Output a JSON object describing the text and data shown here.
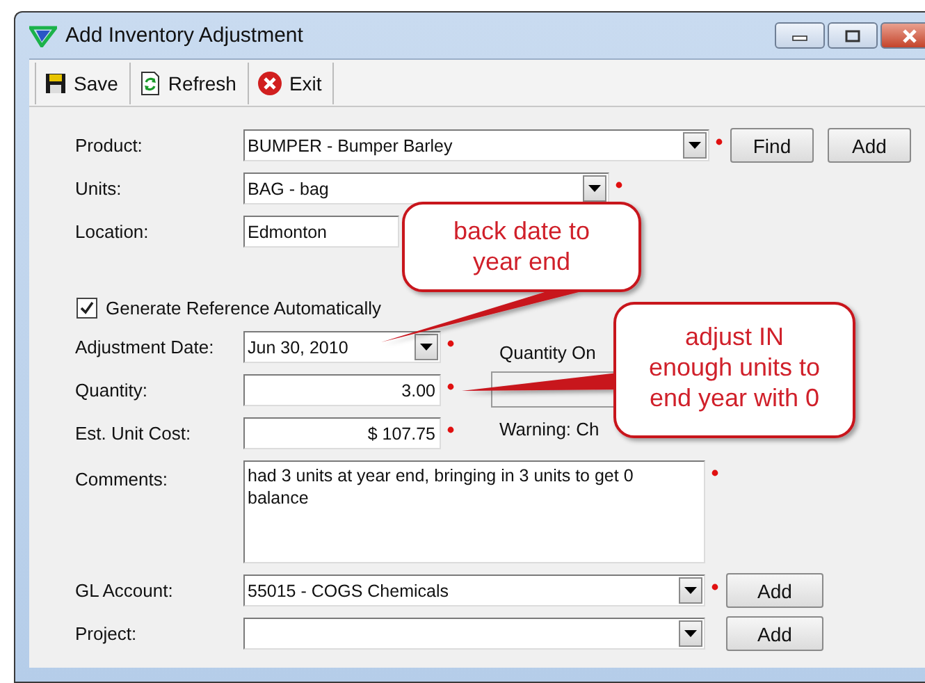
{
  "window": {
    "title": "Add Inventory Adjustment"
  },
  "toolbar": [
    {
      "label": "Save",
      "kind": "save"
    },
    {
      "label": "Refresh",
      "kind": "refresh"
    },
    {
      "label": "Exit",
      "kind": "exit"
    }
  ],
  "product": {
    "label": "Product:",
    "value": "BUMPER - Bumper Barley",
    "required": true,
    "buttons": [
      "Find",
      "Add"
    ]
  },
  "units": {
    "label": "Units:",
    "value": "BAG - bag",
    "required": true
  },
  "location": {
    "label": "Location:",
    "value": "Edmonton"
  },
  "generate_reference": {
    "label": "Generate Reference Automatically",
    "checked": true
  },
  "adjustment_date": {
    "label": "Adjustment Date:",
    "value": "Jun  30, 2010",
    "required": true
  },
  "quantity": {
    "label": "Quantity:",
    "value": "3.00",
    "required": true
  },
  "unit_cost": {
    "label": "Est. Unit Cost:",
    "value": "$ 107.75",
    "required": true
  },
  "quantity_on_hand": {
    "label": "Quantity On",
    "warning": "Warning: Ch"
  },
  "comments": {
    "label": "Comments:",
    "value": "had 3 units at year end, bringing in 3 units to get 0 balance",
    "required": true
  },
  "gl_account": {
    "label": "GL Account:",
    "value": "55015 - COGS Chemicals",
    "required": true,
    "buttons": [
      "Add"
    ]
  },
  "project": {
    "label": "Project:",
    "buttons": [
      "Add"
    ]
  },
  "callouts": [
    {
      "text": "back date to\nyear end"
    },
    {
      "text": "adjust IN\nenough units to\nend year with 0"
    }
  ]
}
